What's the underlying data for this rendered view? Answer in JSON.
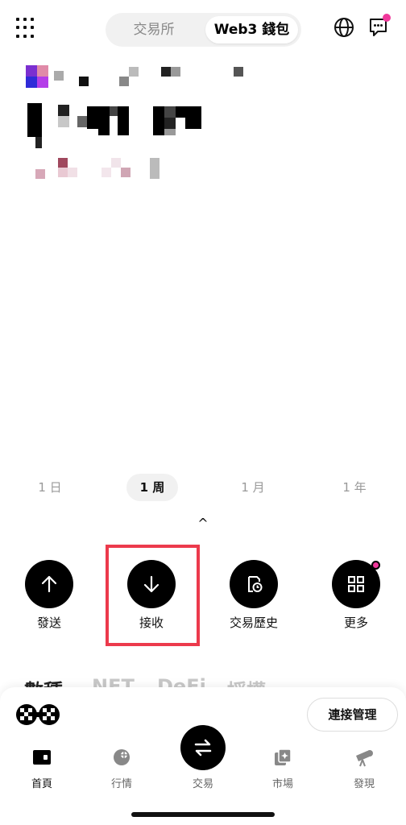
{
  "header": {
    "tabs": [
      {
        "label": "交易所",
        "active": false
      },
      {
        "label": "Web3 錢包",
        "active": true
      }
    ],
    "icons": {
      "menu": "grid-menu-icon",
      "globe": "globe-icon",
      "chat": "chat-icon"
    },
    "notification_color": "#f0389b"
  },
  "balance": {
    "obscured": true
  },
  "timeframes": [
    {
      "label": "1 日",
      "active": false
    },
    {
      "label": "1 周",
      "active": true
    },
    {
      "label": "1 月",
      "active": false
    },
    {
      "label": "1 年",
      "active": false
    }
  ],
  "collapse_caret": "^",
  "actions": [
    {
      "label": "發送",
      "icon": "arrow-up-icon"
    },
    {
      "label": "接收",
      "icon": "arrow-down-icon",
      "highlighted": true
    },
    {
      "label": "交易歷史",
      "icon": "history-icon"
    },
    {
      "label": "更多",
      "icon": "grid-icon",
      "badge": true
    }
  ],
  "highlight_color": "#ec3a4c",
  "asset_tabs": [
    {
      "label": "數種",
      "active": true
    },
    {
      "label": "NFT",
      "active": false
    },
    {
      "label": "DeFi",
      "active": false
    },
    {
      "label": "授權",
      "active": false
    }
  ],
  "connection": {
    "manage_label": "連接管理",
    "logo": "wallet-logo-icon"
  },
  "nav": [
    {
      "label": "首頁",
      "icon": "wallet-icon",
      "active": true
    },
    {
      "label": "行情",
      "icon": "market-icon",
      "active": false
    },
    {
      "label": "交易",
      "icon": "swap-icon",
      "active": false
    },
    {
      "label": "市場",
      "icon": "marketplace-icon",
      "active": false
    },
    {
      "label": "發現",
      "icon": "telescope-icon",
      "active": false
    }
  ]
}
